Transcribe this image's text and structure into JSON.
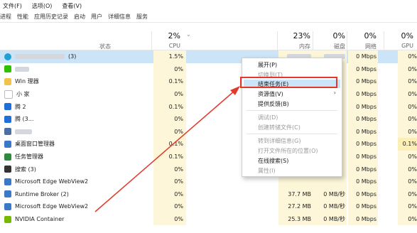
{
  "menu": [
    "文件(F)",
    "选项(O)",
    "查看(V)"
  ],
  "tabs": [
    "进程",
    "性能",
    "应用历史记录",
    "启动",
    "用户",
    "详细信息",
    "服务"
  ],
  "columns": {
    "status": "状态",
    "cpu": {
      "pct": "2%",
      "label": "CPU"
    },
    "mem": {
      "pct": "23%",
      "label": "内存"
    },
    "disk": {
      "pct": "0%",
      "label": "磁盘"
    },
    "net": {
      "pct": "0%",
      "label": "网络"
    },
    "gpu": {
      "pct": "0%",
      "label": "GPU"
    }
  },
  "rows": [
    {
      "name": "(3)",
      "cpu": "1.5%",
      "mem": "",
      "disk": "",
      "net": "0 Mbps",
      "gpu": "0%"
    },
    {
      "name": "",
      "cpu": "0%",
      "mem": "",
      "disk": "",
      "net": "0 Mbps",
      "gpu": "0%"
    },
    {
      "name": "Win 理器",
      "cpu": "0.1%",
      "mem": "",
      "disk": "",
      "net": "0 Mbps",
      "gpu": "0%"
    },
    {
      "name": "小 家",
      "cpu": "0%",
      "mem": "",
      "disk": "",
      "net": "0 Mbps",
      "gpu": "0%"
    },
    {
      "name": "腾 2",
      "cpu": "0.1%",
      "mem": "",
      "disk": "",
      "net": "0 Mbps",
      "gpu": "0%"
    },
    {
      "name": "腾 (3...",
      "cpu": "0%",
      "mem": "",
      "disk": "",
      "net": "0 Mbps",
      "gpu": "0%"
    },
    {
      "name": "",
      "cpu": "0%",
      "mem": "",
      "disk": "",
      "net": "0 Mbps",
      "gpu": "0%"
    },
    {
      "name": "桌面窗口管理器",
      "cpu": "0.1%",
      "mem": "",
      "disk": "",
      "net": "0 Mbps",
      "gpu": "0.1%"
    },
    {
      "name": "任务管理器",
      "cpu": "0.1%",
      "mem": "",
      "disk": "",
      "net": "0 Mbps",
      "gpu": "0%"
    },
    {
      "name": "搜索 (3)",
      "cpu": "0%",
      "mem": "",
      "disk": "",
      "net": "0 Mbps",
      "gpu": "0%"
    },
    {
      "name": "Microsoft Edge WebView2",
      "cpu": "0%",
      "mem": "",
      "disk": "",
      "net": "0 Mbps",
      "gpu": "0%"
    },
    {
      "name": "Runtime Broker (2)",
      "cpu": "0%",
      "mem": "37.7 MB",
      "disk": "0 MB/秒",
      "net": "0 Mbps",
      "gpu": "0%"
    },
    {
      "name": "Microsoft Edge WebView2",
      "cpu": "0%",
      "mem": "27.2 MB",
      "disk": "0 MB/秒",
      "net": "0 Mbps",
      "gpu": "0%"
    },
    {
      "name": "NVIDIA Container",
      "cpu": "0%",
      "mem": "25.3 MB",
      "disk": "0 MB/秒",
      "net": "0 Mbps",
      "gpu": "0%"
    }
  ],
  "context_menu": [
    {
      "label": "展开(P)",
      "enabled": true
    },
    {
      "label": "切换到(T)",
      "enabled": false
    },
    {
      "label": "结束任务(E)",
      "enabled": true
    },
    {
      "label": "资源值(V)",
      "enabled": true,
      "submenu": true
    },
    {
      "label": "提供反馈(B)",
      "enabled": true
    },
    {
      "label": "调试(D)",
      "enabled": false
    },
    {
      "label": "创建转储文件(C)",
      "enabled": false
    },
    {
      "label": "转到详细信息(G)",
      "enabled": false
    },
    {
      "label": "打开文件所在的位置(O)",
      "enabled": false
    },
    {
      "label": "在线搜索(S)",
      "enabled": true
    },
    {
      "label": "属性(I)",
      "enabled": false
    }
  ],
  "colors": {
    "highlight": "#e23a2a",
    "selection": "#cce4f7",
    "heat_light": "#fdf6d8",
    "heat_mid": "#fbeeb6"
  }
}
